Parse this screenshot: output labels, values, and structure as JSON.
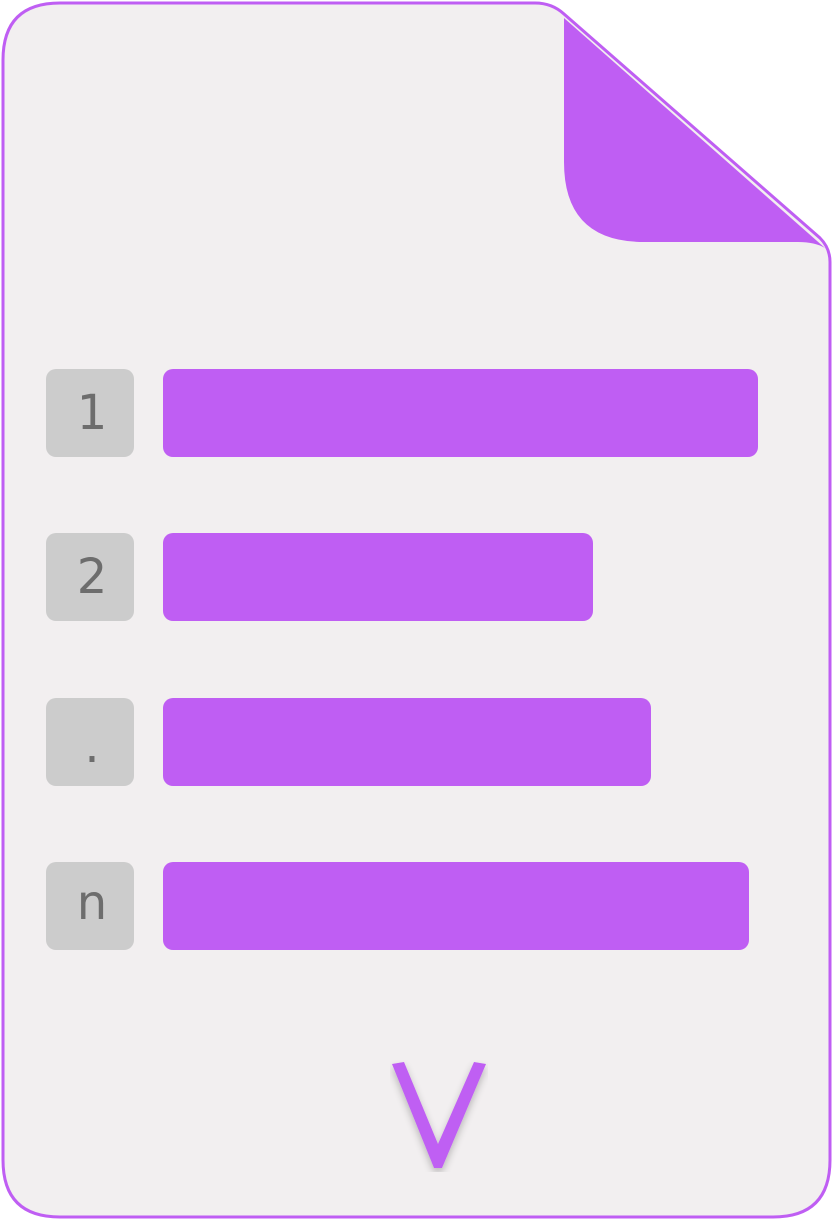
{
  "colors": {
    "accent": "#bf5ef3",
    "page": "#f2eff0",
    "badge": "#cccccc",
    "badge_text": "#6d6d6d"
  },
  "icon": {
    "name": "document-list-icon",
    "rows": [
      {
        "marker": "1",
        "bar_fill": 0.74
      },
      {
        "marker": "2",
        "bar_fill": 0.53
      },
      {
        "marker": ".",
        "bar_fill": 0.61
      },
      {
        "marker": "n",
        "bar_fill": 0.73
      }
    ],
    "logo_letter": "V"
  }
}
